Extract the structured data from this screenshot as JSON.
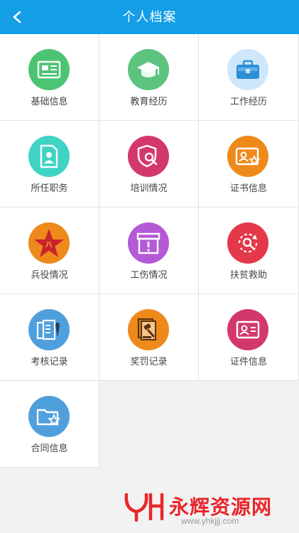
{
  "header": {
    "title": "个人档案",
    "back_icon": "back-arrow-icon"
  },
  "grid": [
    {
      "label": "基础信息",
      "icon": "id-card-icon",
      "color": "#4cc474"
    },
    {
      "label": "教育经历",
      "icon": "graduation-cap-icon",
      "color": "#5cc47e"
    },
    {
      "label": "工作经历",
      "icon": "briefcase-icon",
      "color": "#cfe7fb"
    },
    {
      "label": "所任职务",
      "icon": "badge-person-icon",
      "color": "#3fd3c4"
    },
    {
      "label": "培训情况",
      "icon": "shield-search-icon",
      "color": "#d3386c"
    },
    {
      "label": "证书信息",
      "icon": "certificate-icon",
      "color": "#ee8a1b"
    },
    {
      "label": "兵役情况",
      "icon": "army-star-icon",
      "color": "#ee8a1b"
    },
    {
      "label": "工伤情况",
      "icon": "alert-box-icon",
      "color": "#b45ad6"
    },
    {
      "label": "扶贫救助",
      "icon": "search-refresh-icon",
      "color": "#e5394a"
    },
    {
      "label": "考核记录",
      "icon": "document-tie-icon",
      "color": "#4f9fdd"
    },
    {
      "label": "奖罚记录",
      "icon": "gavel-icon",
      "color": "#ee8a1b"
    },
    {
      "label": "证件信息",
      "icon": "id-card-small-icon",
      "color": "#d3386c"
    },
    {
      "label": "合同信息",
      "icon": "folder-star-icon",
      "color": "#4f9fdd"
    }
  ],
  "watermark": {
    "brand": "永辉资源网",
    "url": "www.yhkjjj.com"
  }
}
